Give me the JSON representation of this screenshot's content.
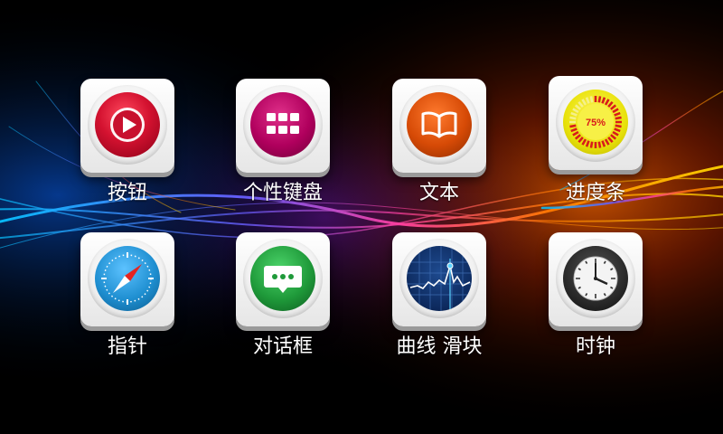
{
  "apps": [
    {
      "label": "按钮",
      "icon": "play-button-icon"
    },
    {
      "label": "个性键盘",
      "icon": "keypad-grid-icon"
    },
    {
      "label": "文本",
      "icon": "open-book-icon"
    },
    {
      "label": "进度条",
      "icon": "progress-gauge-icon",
      "progress_text": "75%",
      "progress_value": 0.75
    },
    {
      "label": "指针",
      "icon": "compass-needle-icon"
    },
    {
      "label": "对话框",
      "icon": "chat-bubble-icon"
    },
    {
      "label": "曲线 滑块",
      "icon": "line-chart-icon"
    },
    {
      "label": "时钟",
      "icon": "analog-clock-icon"
    }
  ],
  "colors": {
    "button": "#c8102e",
    "keyboard": "#b0005d",
    "text": "#d64a06",
    "progress_yellow": "#e8e20a",
    "progress_red": "#d81b1b",
    "compass_blue": "#1f8fd1",
    "dialog_green": "#1f9a3a",
    "chart_navy": "#0d2a5e",
    "clock_dark": "#2a2a2a"
  }
}
